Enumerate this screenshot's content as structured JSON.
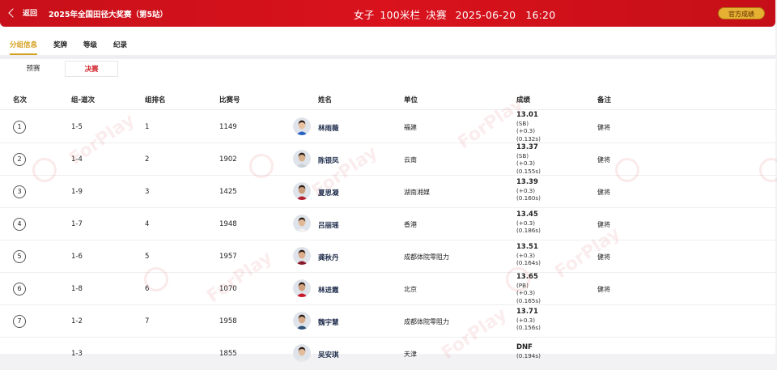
{
  "header": {
    "back_label": "返回",
    "event_title": "2025年全国田径大奖赛（第5站）",
    "gender": "女子",
    "discipline": "100米栏",
    "round": "决赛",
    "date": "2025-06-20",
    "time": "16:20",
    "official_button": "官方成绩"
  },
  "tabs": [
    {
      "label": "分组信息",
      "active": true
    },
    {
      "label": "奖牌",
      "active": false
    },
    {
      "label": "等级",
      "active": false
    },
    {
      "label": "纪录",
      "active": false
    }
  ],
  "subtabs": [
    {
      "label": "预赛",
      "active": false
    },
    {
      "label": "决赛",
      "active": true
    }
  ],
  "columns": {
    "rank": "名次",
    "group_lane": "组-道次",
    "group_rank": "组排名",
    "bib": "比赛号",
    "name": "姓名",
    "unit": "单位",
    "result": "成绩",
    "note": "备注"
  },
  "rows": [
    {
      "rank": "1",
      "group_lane": "1-5",
      "group_rank": "1",
      "bib": "1149",
      "name": "林雨薇",
      "unit": "福建",
      "result": "13.01",
      "extra": [
        "(SB)",
        "(+0.3)",
        "(0.132s)"
      ],
      "note": "健将"
    },
    {
      "rank": "2",
      "group_lane": "1-4",
      "group_rank": "2",
      "bib": "1902",
      "name": "陈银凤",
      "unit": "云南",
      "result": "13.37",
      "extra": [
        "(SB)",
        "(+0.3)",
        "(0.155s)"
      ],
      "note": "健将"
    },
    {
      "rank": "3",
      "group_lane": "1-9",
      "group_rank": "3",
      "bib": "1425",
      "name": "夏思凝",
      "unit": "湖南湘媒",
      "result": "13.39",
      "extra": [
        "(+0.3)",
        "(0.160s)"
      ],
      "note": "健将"
    },
    {
      "rank": "4",
      "group_lane": "1-7",
      "group_rank": "4",
      "bib": "1948",
      "name": "吕丽瑶",
      "unit": "香港",
      "result": "13.45",
      "extra": [
        "(+0.3)",
        "(0.186s)"
      ],
      "note": "健将"
    },
    {
      "rank": "5",
      "group_lane": "1-6",
      "group_rank": "5",
      "bib": "1957",
      "name": "龚秋丹",
      "unit": "成都体院零阻力",
      "result": "13.51",
      "extra": [
        "(+0.3)",
        "(0.164s)"
      ],
      "note": "健将"
    },
    {
      "rank": "6",
      "group_lane": "1-8",
      "group_rank": "6",
      "bib": "1070",
      "name": "林进霞",
      "unit": "北京",
      "result": "13.65",
      "extra": [
        "(PB)",
        "(+0.3)",
        "(0.165s)"
      ],
      "note": "健将"
    },
    {
      "rank": "7",
      "group_lane": "1-2",
      "group_rank": "7",
      "bib": "1958",
      "name": "魏宇慧",
      "unit": "成都体院零阻力",
      "result": "13.71",
      "extra": [
        "(+0.3)",
        "(0.156s)"
      ],
      "note": ""
    },
    {
      "rank": "",
      "group_lane": "1-3",
      "group_rank": "",
      "bib": "1855",
      "name": "吴安琪",
      "unit": "天津",
      "result": "DNF",
      "extra": [
        "(0.194s)"
      ],
      "note": ""
    }
  ],
  "watermark": "ForPlay",
  "colors": {
    "header_red": "#d9121c",
    "accent_gold": "#d4a020",
    "active_red": "#d0202a"
  }
}
